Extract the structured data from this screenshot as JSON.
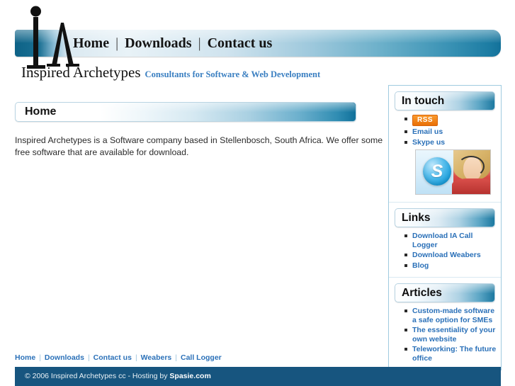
{
  "site": {
    "brand_name": "Inspired Archetypes",
    "tagline": "Consultants for Software & Web Development",
    "logo_alt": "IA monogram logo"
  },
  "nav": {
    "items": [
      {
        "label": "Home"
      },
      {
        "label": "Downloads"
      },
      {
        "label": "Contact us"
      }
    ],
    "separator": "|"
  },
  "main": {
    "heading": "Home",
    "body": "Inspired Archetypes is a Software company based in Stellenbosch, South Africa. We offer some free software that are available for download."
  },
  "sidebar": {
    "sections": [
      {
        "title": "In touch",
        "items": [
          {
            "label": "RSS",
            "style": "badge"
          },
          {
            "label": "Email us",
            "style": "link"
          },
          {
            "label": "Skype us",
            "style": "link"
          }
        ],
        "image": {
          "name": "skype-promo-image",
          "badge_letter": "S"
        }
      },
      {
        "title": "Links",
        "items": [
          {
            "label": "Download IA Call Logger",
            "style": "link"
          },
          {
            "label": "Download Weabers",
            "style": "link"
          },
          {
            "label": "Blog",
            "style": "link"
          }
        ]
      },
      {
        "title": "Articles",
        "items": [
          {
            "label": "Custom-made software a safe option for SMEs",
            "style": "link"
          },
          {
            "label": "The essentiality of your own website",
            "style": "link"
          },
          {
            "label": "Teleworking: The future office",
            "style": "link"
          }
        ]
      }
    ]
  },
  "footer": {
    "links": [
      {
        "label": "Home"
      },
      {
        "label": "Downloads"
      },
      {
        "label": "Contact us"
      },
      {
        "label": "Weabers"
      },
      {
        "label": "Call Logger"
      }
    ],
    "separator": "|",
    "copyright_prefix": "© 2006 Inspired Archetypes cc - Hosting by ",
    "copyright_host": "Spasie.com"
  },
  "colors": {
    "accent_blue": "#17749d",
    "link_blue": "#2a70b8",
    "footer_navy": "#17557f",
    "rss_orange": "#f07d17",
    "sidebar_border": "#9fcbe0"
  }
}
